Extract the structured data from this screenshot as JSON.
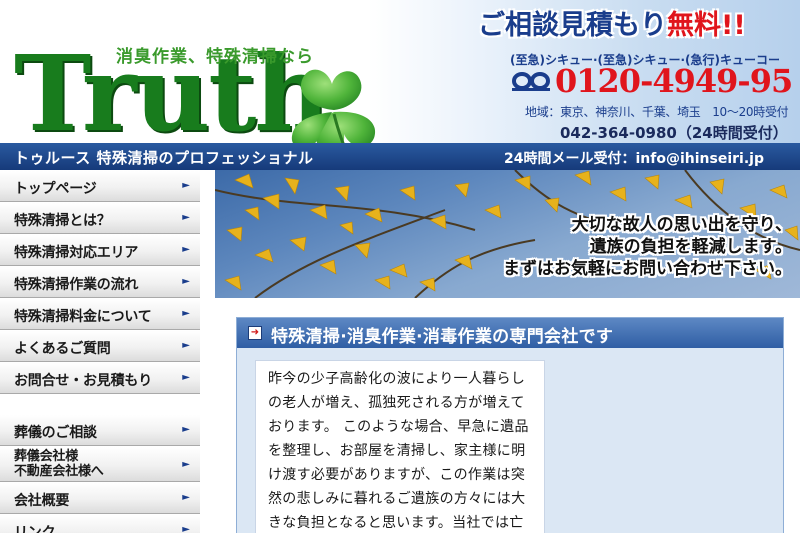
{
  "header": {
    "tagline": "消臭作業、特殊清掃なら",
    "logo_word": "Truth",
    "cta": {
      "title_main": "ご相談見積もり",
      "title_free": "無料!!",
      "dial_reading": "(至急)シキュー·(至急)シキュー·(急行)キューコー",
      "freedial_number": "0120-4949-95",
      "service_area": "地域：東京、神奈川、千葉、埼玉　10～20時受付",
      "phone_line": "042-364-0980（24時間受付）"
    },
    "bar": {
      "subtitle": "トゥルース 特殊清掃のプロフェッショナル",
      "mail_line": "24時間メール受付：info@ihinseiri.jp"
    }
  },
  "sidebar": {
    "primary": [
      {
        "label": "トップページ"
      },
      {
        "label": "特殊清掃とは？"
      },
      {
        "label": "特殊清掃対応エリア"
      },
      {
        "label": "特殊清掃作業の流れ"
      },
      {
        "label": "特殊清掃料金について"
      },
      {
        "label": "よくあるご質問"
      },
      {
        "label": "お問合せ・お見積もり"
      }
    ],
    "secondary": [
      {
        "label": "葬儀のご相談"
      },
      {
        "label": "葬儀会社様\n不動産会社様へ"
      },
      {
        "label": "会社概要"
      },
      {
        "label": "リンク"
      }
    ],
    "arrow_glyph": "►"
  },
  "hero": {
    "lines": [
      "大切な故人の思い出を守り、",
      "遺族の負担を軽減します。",
      "まずはお気軽にお問い合わせ下さい。"
    ]
  },
  "main": {
    "heading": "特殊清掃·消臭作業·消毒作業の専門会社です",
    "heading_icon_glyph": "➜",
    "body": "昨今の少子高齢化の波により一人暮らしの老人が増え、孤独死される方が増えております。 このような場合、早急に遺品を整理し、お部屋を清掃し、家主様に明け渡す必要がありますが、この作業は突然の悲しみに暮れるご遺族の方々には大きな負担となると思います。当社では亡くなられた故人のお部"
  },
  "colors": {
    "logo_green": "#187c1d",
    "brand_blue": "#1a3d8c",
    "accent_red": "#e0151c",
    "bar_blue": "#163a7a"
  }
}
